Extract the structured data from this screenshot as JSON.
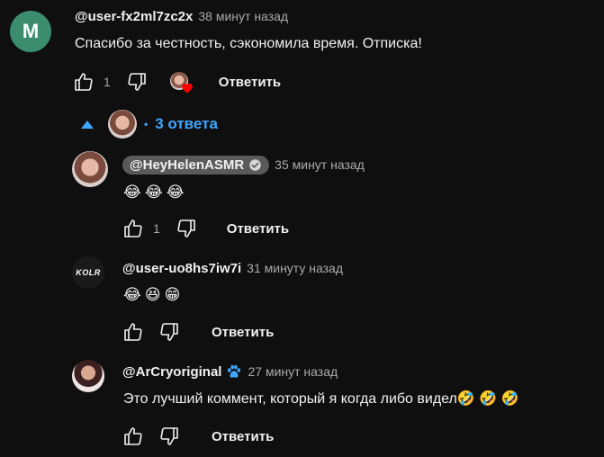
{
  "top_comment": {
    "avatar_letter": "M",
    "author": "@user-fx2ml7zc2x",
    "time": "38 минут назад",
    "text": "Спасибо за честность, сэкономила время. Отписка!",
    "like_count": "1",
    "reply_label": "Ответить"
  },
  "replies_toggle": {
    "label": "3 ответа"
  },
  "replies": [
    {
      "author": "@HeyHelenASMR",
      "time": "35 минут назад",
      "text": "😂😂😂",
      "like_count": "1",
      "reply_label": "Ответить"
    },
    {
      "author": "@user-uo8hs7iw7i",
      "avatar_text": "KOLR",
      "time": "31 минуту назад",
      "text": "😂😆😁",
      "reply_label": "Ответить"
    },
    {
      "author": "@ArCryoriginal",
      "time": "27 минут назад",
      "text": "Это лучший коммент, который  я когда либо видел🤣 🤣 🤣",
      "reply_label": "Ответить"
    }
  ],
  "colors": {
    "background": "#0f0f0f",
    "link": "#3ea6ff",
    "avatar_m": "#3c8c70",
    "heart": "#ff0000"
  }
}
